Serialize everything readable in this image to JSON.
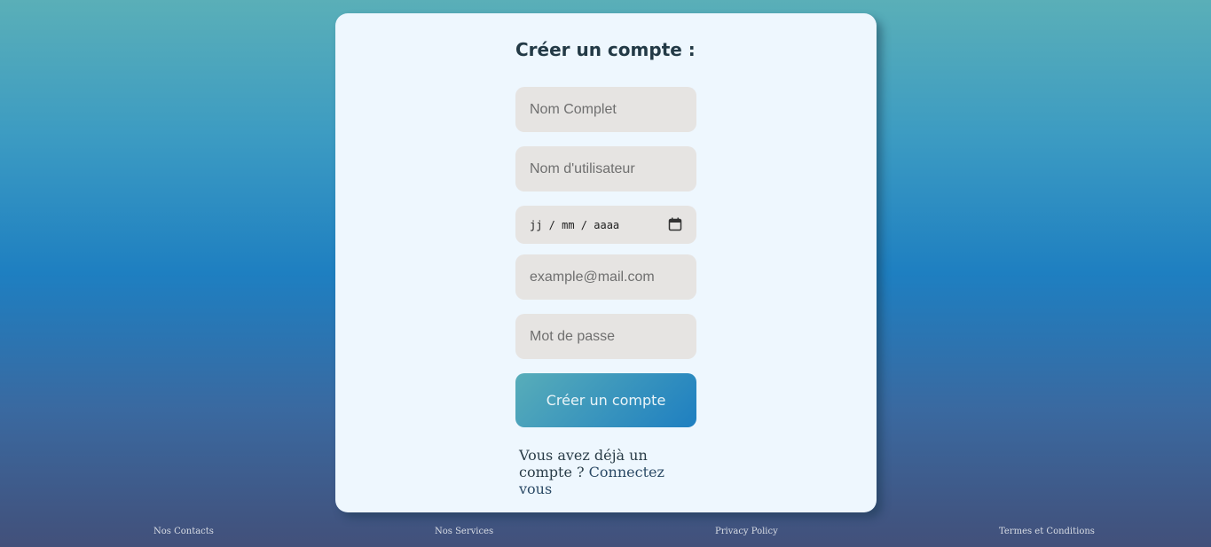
{
  "form": {
    "title": "Créer un compte :",
    "fields": {
      "full_name_placeholder": "Nom Complet",
      "username_placeholder": "Nom d'utilisateur",
      "date_placeholder": "jj / mm / aaaa",
      "email_placeholder": "example@mail.com",
      "password_placeholder": "Mot de passe"
    },
    "submit_label": "Créer un compte",
    "login_prompt": "Vous avez déjà un compte ?",
    "login_link": "Connectez vous"
  },
  "footer": {
    "links": [
      "Nos Contacts",
      "Nos Services",
      "Privacy Policy",
      "Termes et Conditions"
    ]
  },
  "icons": {
    "date": "calendar-icon"
  },
  "colors": {
    "card_background": "#eef7fe",
    "field_background": "#e6e4e2",
    "button_gradient_start": "#58adb9",
    "button_gradient_end": "#1e7fc1"
  }
}
